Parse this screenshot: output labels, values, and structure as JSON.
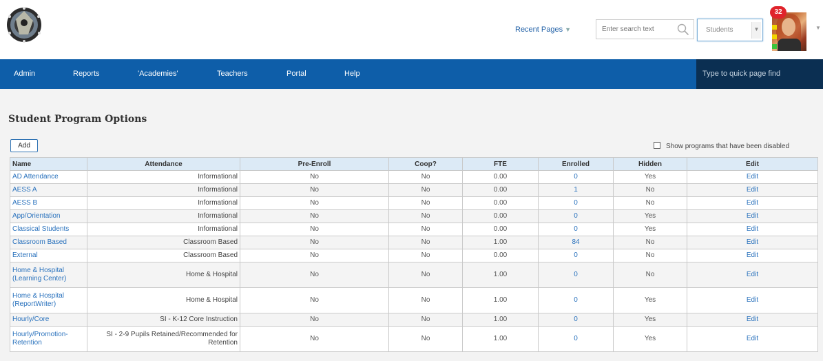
{
  "header": {
    "recent_pages": "Recent Pages",
    "search_placeholder": "Enter search text",
    "scope_select": "Students",
    "notifications": "32"
  },
  "nav": {
    "items": [
      "Admin",
      "Reports",
      "'Academies'",
      "Teachers",
      "Portal",
      "Help"
    ],
    "quick_find": "Type to quick page find"
  },
  "page": {
    "title": "Student Program Options",
    "add_label": "Add",
    "show_disabled_label": "Show programs that have been disabled"
  },
  "table": {
    "columns": [
      "Name",
      "Attendance",
      "Pre-Enroll",
      "Coop?",
      "FTE",
      "Enrolled",
      "Hidden",
      "Edit"
    ],
    "rows": [
      {
        "name": "AD Attendance",
        "attendance": "Informational",
        "pre_enroll": "No",
        "coop": "No",
        "fte": "0.00",
        "enrolled": "0",
        "hidden": "Yes",
        "edit": "Edit"
      },
      {
        "name": "AESS A",
        "attendance": "Informational",
        "pre_enroll": "No",
        "coop": "No",
        "fte": "0.00",
        "enrolled": "1",
        "hidden": "No",
        "edit": "Edit"
      },
      {
        "name": "AESS B",
        "attendance": "Informational",
        "pre_enroll": "No",
        "coop": "No",
        "fte": "0.00",
        "enrolled": "0",
        "hidden": "No",
        "edit": "Edit"
      },
      {
        "name": "App/Orientation",
        "attendance": "Informational",
        "pre_enroll": "No",
        "coop": "No",
        "fte": "0.00",
        "enrolled": "0",
        "hidden": "Yes",
        "edit": "Edit"
      },
      {
        "name": "Classical Students",
        "attendance": "Informational",
        "pre_enroll": "No",
        "coop": "No",
        "fte": "0.00",
        "enrolled": "0",
        "hidden": "Yes",
        "edit": "Edit"
      },
      {
        "name": "Classroom Based",
        "attendance": "Classroom Based",
        "pre_enroll": "No",
        "coop": "No",
        "fte": "1.00",
        "enrolled": "84",
        "hidden": "No",
        "edit": "Edit"
      },
      {
        "name": "External",
        "attendance": "Classroom Based",
        "pre_enroll": "No",
        "coop": "No",
        "fte": "0.00",
        "enrolled": "0",
        "hidden": "No",
        "edit": "Edit"
      },
      {
        "name": "Home & Hospital (Learning Center)",
        "attendance": "Home & Hospital",
        "pre_enroll": "No",
        "coop": "No",
        "fte": "1.00",
        "enrolled": "0",
        "hidden": "No",
        "edit": "Edit"
      },
      {
        "name": "Home & Hospital (ReportWriter)",
        "attendance": "Home & Hospital",
        "pre_enroll": "No",
        "coop": "No",
        "fte": "1.00",
        "enrolled": "0",
        "hidden": "Yes",
        "edit": "Edit"
      },
      {
        "name": "Hourly/Core",
        "attendance": "SI - K-12 Core Instruction",
        "pre_enroll": "No",
        "coop": "No",
        "fte": "1.00",
        "enrolled": "0",
        "hidden": "Yes",
        "edit": "Edit"
      },
      {
        "name": "Hourly/Promotion-Retention",
        "attendance": "SI - 2-9 Pupils Retained/Recommended for Retention",
        "pre_enroll": "No",
        "coop": "No",
        "fte": "1.00",
        "enrolled": "0",
        "hidden": "Yes",
        "edit": "Edit"
      }
    ]
  }
}
